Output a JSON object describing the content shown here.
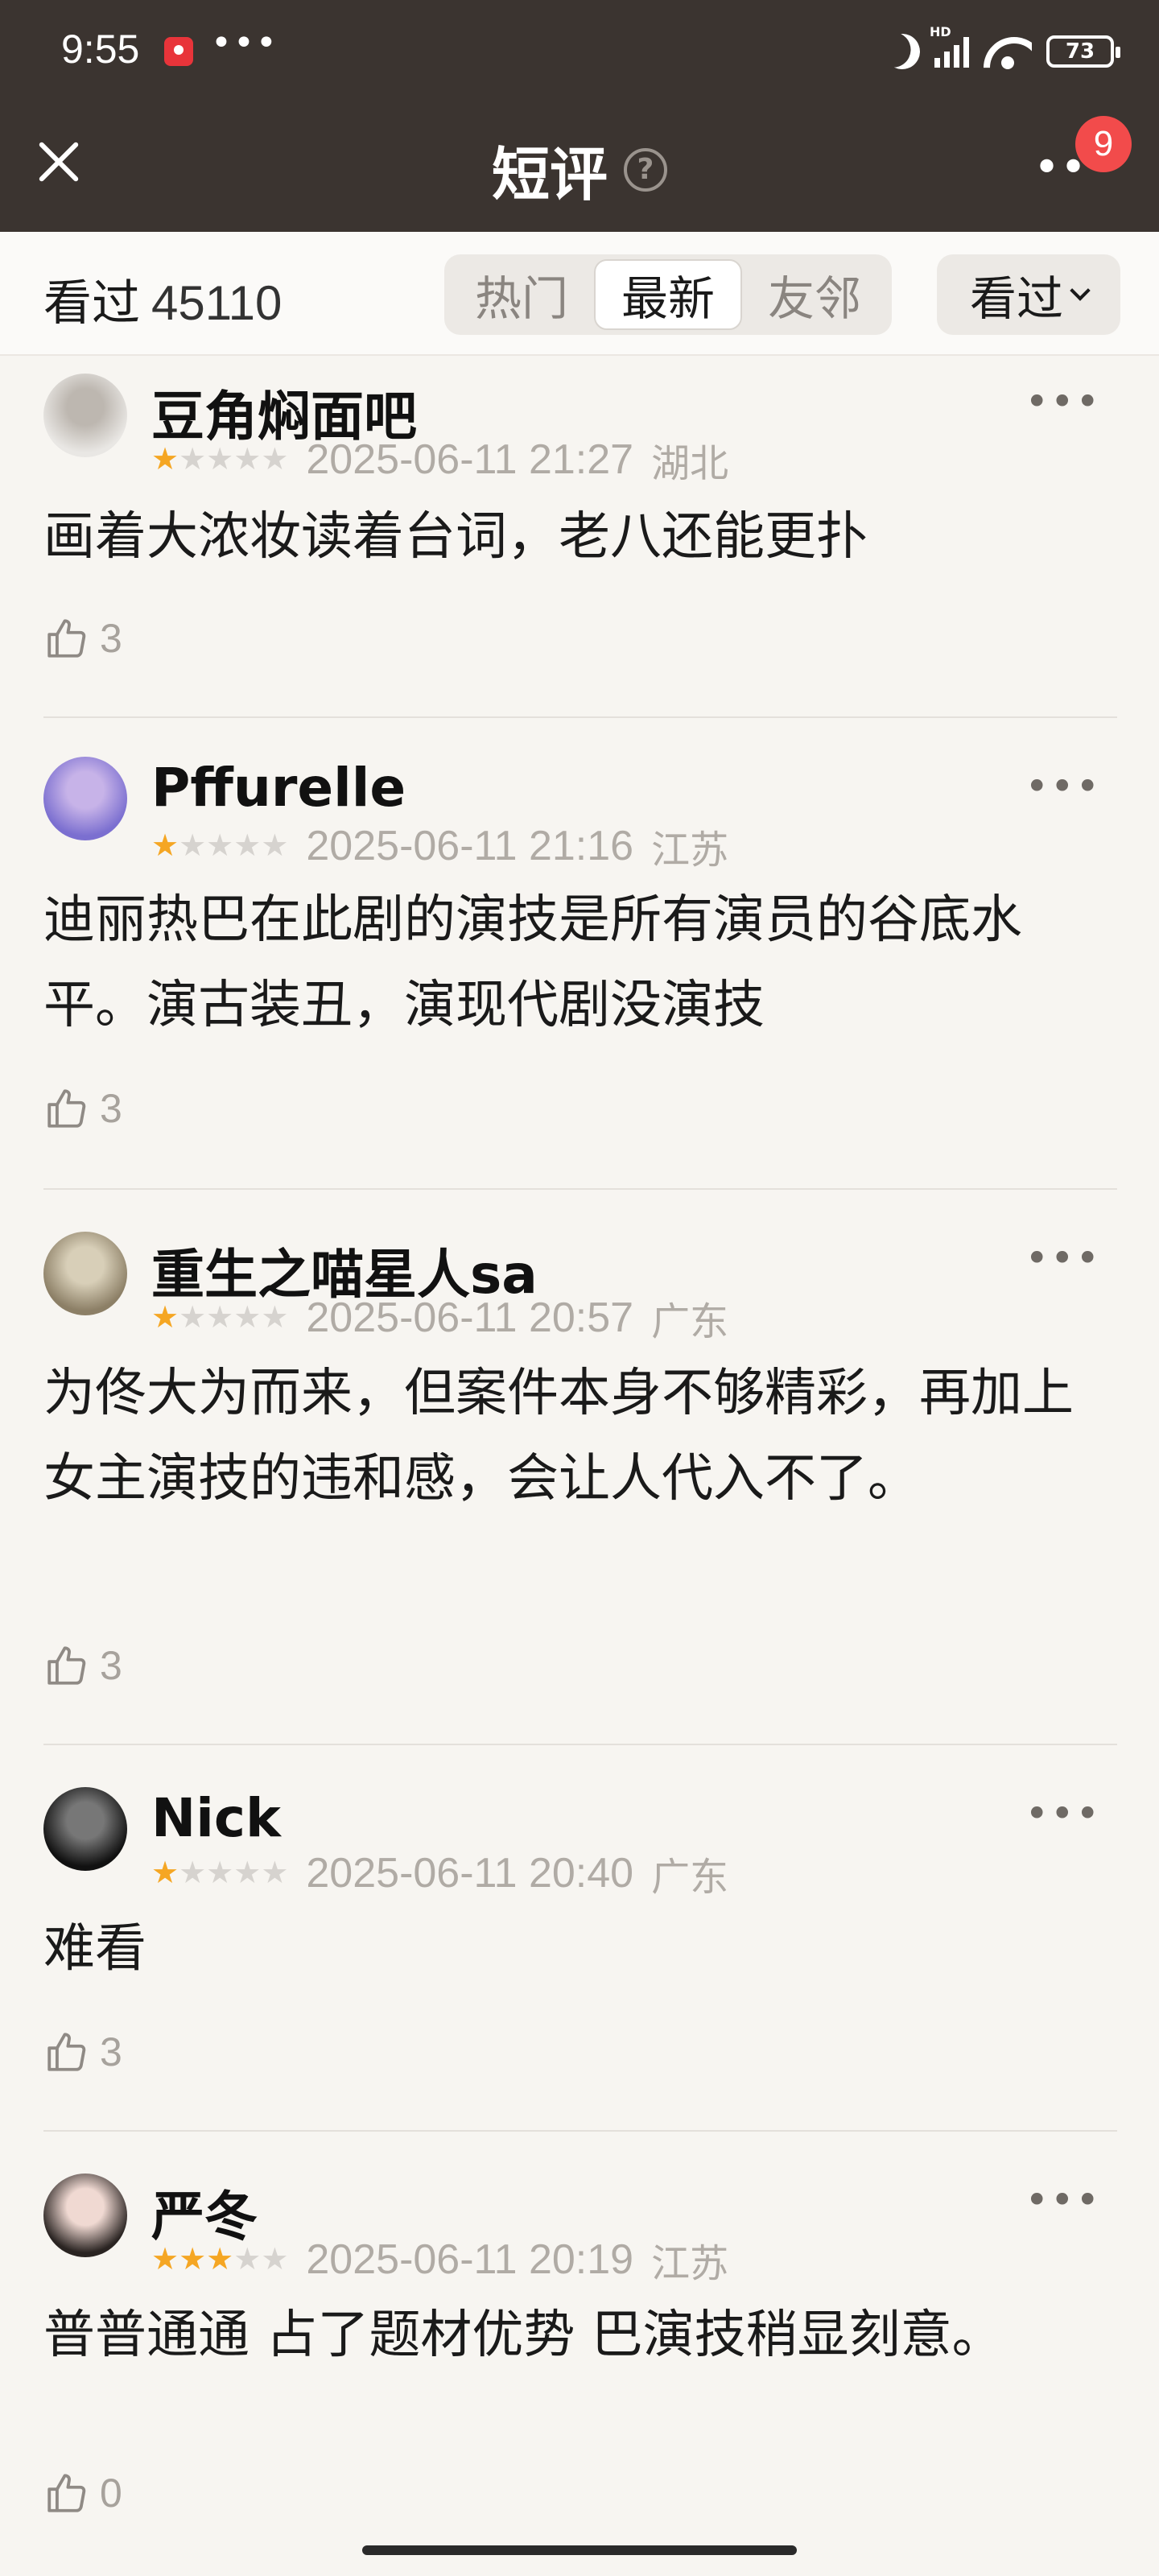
{
  "status_bar": {
    "time": "9:55",
    "more": "•••",
    "hd": "HD",
    "battery": "73"
  },
  "nav": {
    "title": "短评",
    "help": "?",
    "more": "••",
    "badge": "9"
  },
  "filter": {
    "seen_label": "看过",
    "seen_count": "45110",
    "tabs": [
      {
        "label": "热门"
      },
      {
        "label": "最新"
      },
      {
        "label": "友邻"
      }
    ],
    "sort_label": "看过"
  },
  "reviews": [
    {
      "user": "豆角焖面吧",
      "stars": 1,
      "time": "2025-06-11 21:27",
      "location": "湖北",
      "text": "画着大浓妆读着台词，老八还能更扑",
      "likes": "3",
      "avatar_colors": [
        "#e9e7e4",
        "#bdb7b0"
      ]
    },
    {
      "user": "Pffurelle",
      "stars": 1,
      "time": "2025-06-11 21:16",
      "location": "江苏",
      "text": "迪丽热巴在此剧的演技是所有演员的谷底水平。演古装丑，演现代剧没演技",
      "likes": "3",
      "avatar_colors": [
        "#7b6fd0",
        "#c7b3e8"
      ]
    },
    {
      "user": "重生之喵星人sa",
      "stars": 1,
      "time": "2025-06-11 20:57",
      "location": "广东",
      "text": "为佟大为而来，但案件本身不够精彩，再加上女主演技的违和感，会让人代入不了。",
      "likes": "3",
      "avatar_colors": [
        "#8c7f66",
        "#d8cfb8"
      ]
    },
    {
      "user": "Nick",
      "stars": 1,
      "time": "2025-06-11 20:40",
      "location": "广东",
      "text": "难看",
      "likes": "3",
      "avatar_colors": [
        "#111111",
        "#777777"
      ]
    },
    {
      "user": "严冬",
      "stars": 3,
      "time": "2025-06-11 20:19",
      "location": "江苏",
      "text": "普普通通 占了题材优势 巴演技稍显刻意。",
      "likes": "0",
      "avatar_colors": [
        "#2a2422",
        "#f0d9d2"
      ]
    }
  ]
}
